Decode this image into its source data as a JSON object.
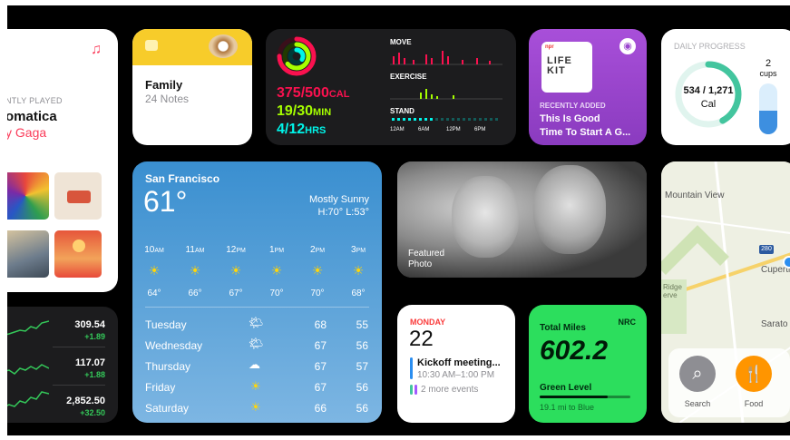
{
  "music": {
    "caption": "NTLY PLAYED",
    "title": "omatica",
    "artist": "y Gaga",
    "icon": "music-note-icon"
  },
  "notes": {
    "title": "Family",
    "count": "24 Notes"
  },
  "activity": {
    "move": "375/500",
    "move_unit": "CAL",
    "exercise": "19/30",
    "exercise_unit": "MIN",
    "stand": "4/12",
    "stand_unit": "HRS",
    "labels": {
      "move": "MOVE",
      "exercise": "EXERCISE",
      "stand": "STAND"
    },
    "ticks": [
      "12AM",
      "6AM",
      "12PM",
      "6PM"
    ],
    "colors": {
      "move": "#fa114f",
      "exercise": "#a6ff00",
      "stand": "#00f5ea"
    }
  },
  "podcast": {
    "tag": "RECENTLY ADDED",
    "title": "This Is Good",
    "subtitle": "Time To Start A G...",
    "art_text": "LIFE KIT"
  },
  "fitness": {
    "header": "DAILY PROGRESS",
    "value": "534 / 1,271",
    "unit": "Cal",
    "cups": "2",
    "cups_label": "cups",
    "progress": 0.42
  },
  "weather": {
    "city": "San Francisco",
    "temp": "61°",
    "condition": "Mostly Sunny",
    "hilo": "H:70°  L:53°",
    "hours": [
      {
        "time": "10",
        "ampm": "AM",
        "temp": "64°"
      },
      {
        "time": "11",
        "ampm": "AM",
        "temp": "66°"
      },
      {
        "time": "12",
        "ampm": "PM",
        "temp": "67°"
      },
      {
        "time": "1",
        "ampm": "PM",
        "temp": "70°"
      },
      {
        "time": "2",
        "ampm": "PM",
        "temp": "70°"
      },
      {
        "time": "3",
        "ampm": "PM",
        "temp": "68°"
      }
    ],
    "days": [
      {
        "name": "Tuesday",
        "hi": "68",
        "lo": "55"
      },
      {
        "name": "Wednesday",
        "hi": "67",
        "lo": "56"
      },
      {
        "name": "Thursday",
        "hi": "67",
        "lo": "57"
      },
      {
        "name": "Friday",
        "hi": "67",
        "lo": "56"
      },
      {
        "name": "Saturday",
        "hi": "66",
        "lo": "56"
      }
    ]
  },
  "photo": {
    "label1": "Featured",
    "label2": "Photo"
  },
  "stocks": [
    {
      "price": "309.54",
      "change": "+1.89"
    },
    {
      "price": "117.07",
      "change": "+1.88"
    },
    {
      "price": "2,852.50",
      "change": "+32.50"
    }
  ],
  "calendar": {
    "weekday": "MONDAY",
    "date": "22",
    "event": "Kickoff meeting...",
    "time": "10:30 AM–1:00 PM",
    "more": "2 more events"
  },
  "nike": {
    "label": "Total Miles",
    "brand": "NRC",
    "miles": "602.2",
    "level": "Green Level",
    "sub": "19.1 mi to Blue",
    "level_progress": 0.75
  },
  "maps": {
    "city1": "Mountain View",
    "city2": "Cupertino",
    "city3": "Sarato",
    "area": "Ridge",
    "area2": "erve",
    "highway": "280",
    "search": "Search",
    "food": "Food"
  }
}
